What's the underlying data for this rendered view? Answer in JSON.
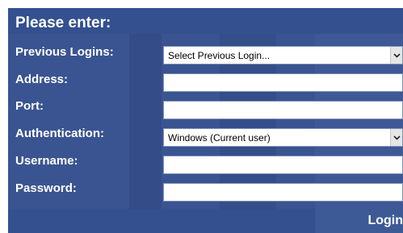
{
  "form": {
    "title": "Please enter:",
    "previous_logins": {
      "label": "Previous Logins:",
      "selected": "Select Previous Login..."
    },
    "address": {
      "label": "Address:",
      "value": ""
    },
    "port": {
      "label": "Port:",
      "value": ""
    },
    "authentication": {
      "label": "Authentication:",
      "selected": "Windows (Current user)"
    },
    "username": {
      "label": "Username:",
      "value": ""
    },
    "password": {
      "label": "Password:",
      "value": ""
    },
    "login_label": "Login"
  },
  "icons": {
    "dropdown": "chevron-down-icon"
  },
  "colors": {
    "panel_background": "#3a5491",
    "label_text": "#ffffff",
    "field_background": "#ffffff"
  }
}
